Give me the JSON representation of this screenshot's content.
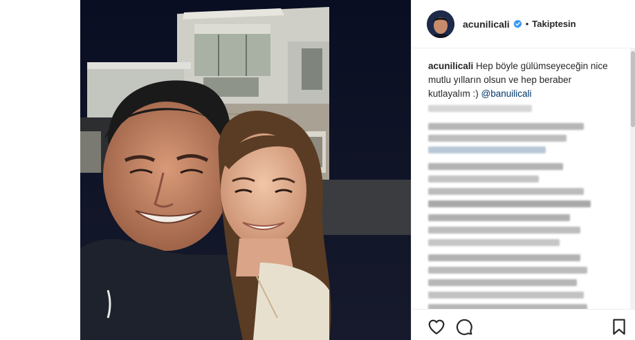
{
  "post": {
    "username": "acunilicali",
    "follow_status": "Takiptesin",
    "caption": {
      "username": "acunilicali",
      "text": "Hep böyle gülümseyeceğin nice mutlu yılların olsun ve hep beraber kutlayalım :)",
      "mention": "@banuilicali"
    }
  },
  "colors": {
    "verified": "#3897f0",
    "text": "#262626",
    "mention": "#003569"
  },
  "icons": [
    "heart-icon",
    "comment-icon",
    "bookmark-icon",
    "verified-badge-icon"
  ]
}
